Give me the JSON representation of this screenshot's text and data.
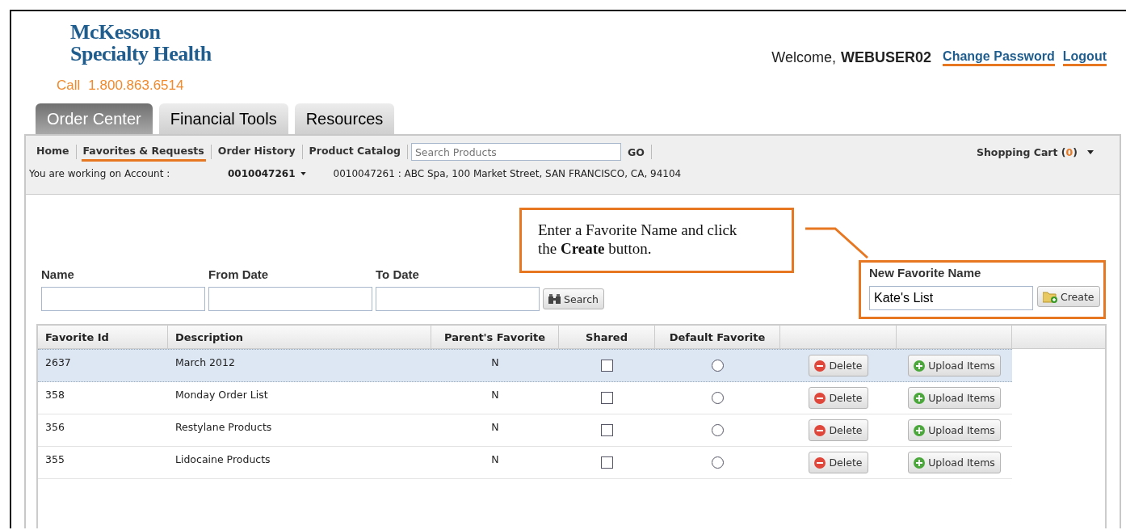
{
  "header": {
    "logo_line1": "McKesson",
    "logo_line2": "Specialty Health",
    "call_label": "Call",
    "phone": "1.800.863.6514",
    "welcome": "Welcome,",
    "username": "WEBUSER02",
    "links": [
      "Change Password",
      "Logout"
    ]
  },
  "tabs": [
    {
      "label": "Order Center",
      "selected": true
    },
    {
      "label": "Financial Tools",
      "selected": false
    },
    {
      "label": "Resources",
      "selected": false
    }
  ],
  "nav": {
    "items": [
      {
        "label": "Home",
        "selected": false
      },
      {
        "label": "Favorites & Requests",
        "selected": true
      },
      {
        "label": "Order History",
        "selected": false
      },
      {
        "label": "Product Catalog",
        "selected": false
      }
    ],
    "search": {
      "placeholder": "Search Products",
      "button": "GO"
    },
    "cart": {
      "label": "Shopping Cart (",
      "count": "0",
      "close": ")"
    }
  },
  "account": {
    "label": "You are working on Account :",
    "number": "0010047261",
    "address": "0010047261 : ABC Spa, 100 Market Street, SAN FRANCISCO, CA, 94104"
  },
  "callout": {
    "text": "Enter a Favorite Name and click the **Create** button."
  },
  "filters": {
    "fields": [
      {
        "label": "Name"
      },
      {
        "label": "From Date"
      },
      {
        "label": "To Date"
      }
    ],
    "button": "Search"
  },
  "new_favorite": {
    "label": "New Favorite Name",
    "value": "Kate's List",
    "button": "Create"
  },
  "table": {
    "columns": [
      "Favorite Id",
      "Description",
      "Parent's Favorite",
      "Shared",
      "Default Favorite"
    ],
    "rows": [
      {
        "id": "2637",
        "description": "March 2012",
        "parent": "N",
        "shared": false,
        "default": false,
        "selected": true,
        "delete": "Delete",
        "upload": "Upload Items"
      },
      {
        "id": "358",
        "description": "Monday Order List",
        "parent": "N",
        "shared": false,
        "default": false,
        "selected": false,
        "delete": "Delete",
        "upload": "Upload Items"
      },
      {
        "id": "356",
        "description": "Restylane Products",
        "parent": "N",
        "shared": false,
        "default": false,
        "selected": false,
        "delete": "Delete",
        "upload": "Upload Items"
      },
      {
        "id": "355",
        "description": "Lidocaine Products",
        "parent": "N",
        "shared": false,
        "default": false,
        "selected": false,
        "delete": "Delete",
        "upload": "Upload Items"
      }
    ]
  }
}
